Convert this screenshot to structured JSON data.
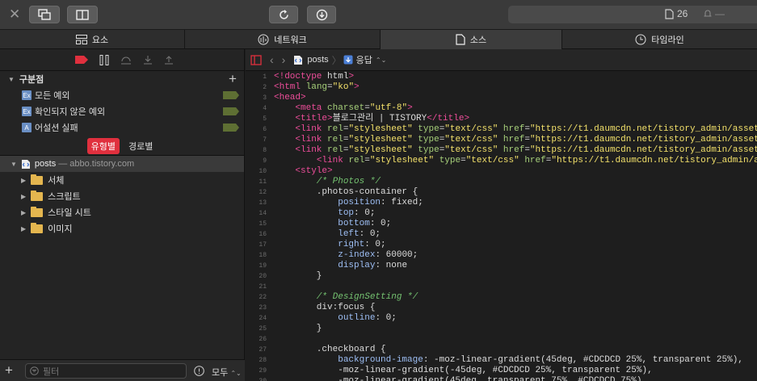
{
  "titlebar": {
    "resource_count": "26",
    "alert_label": "—"
  },
  "tabs": [
    {
      "label": "요소",
      "icon": "elements-icon",
      "active": false
    },
    {
      "label": "네트워크",
      "icon": "network-icon",
      "active": false
    },
    {
      "label": "소스",
      "icon": "document-icon",
      "active": true
    },
    {
      "label": "타임라인",
      "icon": "clock-icon",
      "active": false
    }
  ],
  "breakpoints": {
    "header": "구분점",
    "items": [
      {
        "label": "모든 예외",
        "icon_text": "Ex"
      },
      {
        "label": "확인되지 않은 예외",
        "icon_text": "Ex"
      },
      {
        "label": "어설션 실패",
        "icon_text": "A"
      }
    ]
  },
  "group_by": {
    "active": "유형별",
    "inactive": "경로별"
  },
  "tree": {
    "root_name": "posts",
    "root_host": "— abbo.tistory.com",
    "folders": [
      "서체",
      "스크립트",
      "스타일 시트",
      "이미지"
    ]
  },
  "filter": {
    "placeholder": "필터",
    "scope": "모두"
  },
  "main": {
    "file": "posts",
    "response": "응답"
  },
  "code_lines": [
    "<!doctype html>",
    "<html lang=\"ko\">",
    "<head>",
    "    <meta charset=\"utf-8\">",
    "    <title>블로그관리 | TISTORY</title>",
    "    <link rel=\"stylesheet\" type=\"text/css\" href=\"https://t1.daumcdn.net/tistory_admin/assets/",
    "    <link rel=\"stylesheet\" type=\"text/css\" href=\"https://t1.daumcdn.net/tistory_admin/assets/",
    "    <link rel=\"stylesheet\" type=\"text/css\" href=\"https://t1.daumcdn.net/tistory_admin/assets/",
    "        <link rel=\"stylesheet\" type=\"text/css\" href=\"https://t1.daumcdn.net/tistory_admin/as",
    "    <style>",
    "        /* Photos */",
    "        .photos-container {",
    "            position: fixed;",
    "            top: 0;",
    "            bottom: 0;",
    "            left: 0;",
    "            right: 0;",
    "            z-index: 60000;",
    "            display: none",
    "        }",
    "",
    "        /* DesignSetting */",
    "        div:focus {",
    "            outline: 0;",
    "        }",
    "",
    "        .checkboard {",
    "            background-image: -moz-linear-gradient(45deg, #CDCDCD 25%, transparent 25%),",
    "            -moz-linear-gradient(-45deg, #CDCDCD 25%, transparent 25%),",
    "            -moz-linear-gradient(45deg, transparent 75%, #CDCDCD 75%),"
  ],
  "colors": {
    "accent_red": "#e0303e",
    "folder": "#e4b64f",
    "tag": "#ef4d9b",
    "attr": "#a7d07a",
    "string": "#f3e16a",
    "comment": "#74c170"
  }
}
